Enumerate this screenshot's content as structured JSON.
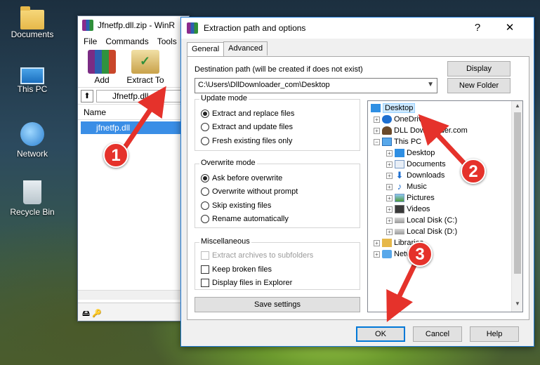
{
  "desktop": {
    "icons": [
      {
        "label": "Documents",
        "icon": "folder-icon"
      },
      {
        "label": "This PC",
        "icon": "computer-icon"
      },
      {
        "label": "Network",
        "icon": "network-icon"
      },
      {
        "label": "Recycle Bin",
        "icon": "recycle-bin-icon"
      }
    ]
  },
  "winrar": {
    "title": "Jfnetfp.dll.zip - WinR",
    "menu": [
      "File",
      "Commands",
      "Tools"
    ],
    "toolbar": {
      "add": "Add",
      "extract_to": "Extract To"
    },
    "address": "Jfnetfp.dll.zi",
    "column_name": "Name",
    "file_row": "jfnetfp.dll"
  },
  "dialog": {
    "title": "Extraction path and options",
    "help_symbol": "?",
    "close_symbol": "✕",
    "tabs": [
      "General",
      "Advanced"
    ],
    "dest_label": "Destination path (will be created if does not exist)",
    "dest_value": "C:\\Users\\DllDownloader_com\\Desktop",
    "display_btn": "Display",
    "new_folder_btn": "New Folder",
    "update_mode": {
      "title": "Update mode",
      "options": [
        "Extract and replace files",
        "Extract and update files",
        "Fresh existing files only"
      ],
      "selected": 0
    },
    "overwrite_mode": {
      "title": "Overwrite mode",
      "options": [
        "Ask before overwrite",
        "Overwrite without prompt",
        "Skip existing files",
        "Rename automatically"
      ],
      "selected": 0
    },
    "misc": {
      "title": "Miscellaneous",
      "options": [
        "Extract archives to subfolders",
        "Keep broken files",
        "Display files in Explorer"
      ]
    },
    "save_settings": "Save settings",
    "tree": [
      "Desktop",
      "OneDrive",
      "DLL Downloader.com",
      "This PC",
      "Desktop",
      "Documents",
      "Downloads",
      "Music",
      "Pictures",
      "Videos",
      "Local Disk (C:)",
      "Local Disk (D:)",
      "Libraries",
      "Network"
    ],
    "ok": "OK",
    "cancel": "Cancel",
    "help": "Help"
  },
  "annotations": [
    "1",
    "2",
    "3"
  ],
  "colors": {
    "marker": "#e5322b",
    "selection": "#3a8ee6",
    "accent": "#0078d7"
  }
}
